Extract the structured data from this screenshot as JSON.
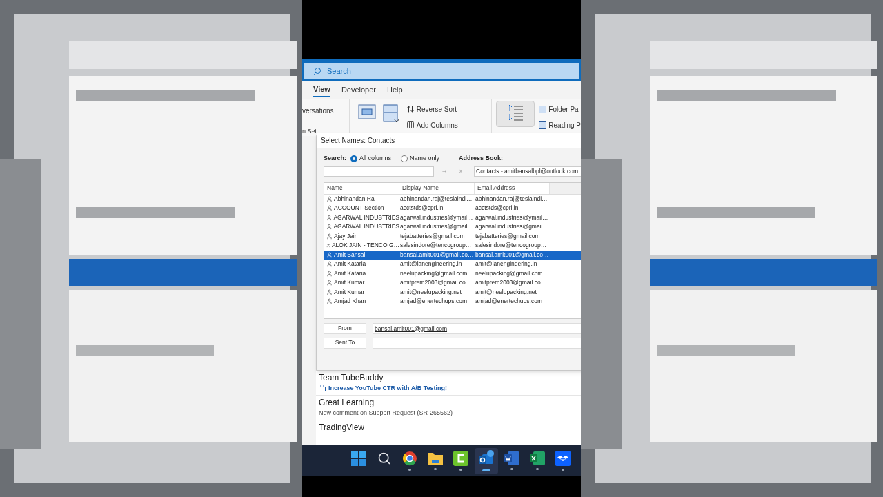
{
  "search": {
    "placeholder": "Search"
  },
  "ribbon_tabs": [
    {
      "label": "View",
      "selected": true
    },
    {
      "label": "Developer",
      "selected": false
    },
    {
      "label": "Help",
      "selected": false
    }
  ],
  "ribbon": {
    "left_labels": [
      "versations",
      "n Set"
    ],
    "commands": [
      "Reverse Sort",
      "Add Columns"
    ],
    "pane_commands": [
      "Folder Pa",
      "Reading P"
    ]
  },
  "dialog": {
    "title": "Select Names: Contacts",
    "search_label": "Search:",
    "search_options": [
      {
        "label": "All columns",
        "selected": true
      },
      {
        "label": "Name only",
        "selected": false
      }
    ],
    "arrow": "→",
    "clear": "×",
    "address_book_label": "Address Book:",
    "address_book": "Contacts - amitbansalbpl@outlook.com",
    "columns": [
      "Name",
      "Display Name",
      "Email Address"
    ],
    "rows": [
      {
        "name": "Abhinandan Raj",
        "display": "abhinandan.raj@teslaindi…",
        "email": "abhinandan.raj@teslaindi…",
        "selected": false
      },
      {
        "name": "ACCOUNT Section",
        "display": "acctstds@cpri.in",
        "email": "acctstds@cpri.in",
        "selected": false
      },
      {
        "name": "AGARWAL INDUSTRIES",
        "display": "agarwal.industries@ymail…",
        "email": "agarwal.industries@ymail…",
        "selected": false
      },
      {
        "name": "AGARWAL INDUSTRIES",
        "display": "agarwal.industries@gmail…",
        "email": "agarwal.industries@gmail…",
        "selected": false
      },
      {
        "name": "Ajay Jain",
        "display": "tejabatteries@gmail.com",
        "email": "tejabatteries@gmail.com",
        "selected": false
      },
      {
        "name": "ALOK JAIN - TENCO G…",
        "display": "salesindore@tencogroup…",
        "email": "salesindore@tencogroup…",
        "selected": false
      },
      {
        "name": "Amit Bansal",
        "display": "bansal.amit001@gmail.co…",
        "email": "bansal.amit001@gmail.co…",
        "selected": true
      },
      {
        "name": "Amit Kataria",
        "display": "amit@lanengineering.in",
        "email": "amit@lanengineering.in",
        "selected": false
      },
      {
        "name": "Amit Kataria",
        "display": "neelupacking@gmail.com",
        "email": "neelupacking@gmail.com",
        "selected": false
      },
      {
        "name": "Amit Kumar",
        "display": "amitprem2003@gmail.co…",
        "email": "amitprem2003@gmail.co…",
        "selected": false
      },
      {
        "name": "Amit Kumar",
        "display": "amit@neelupacking.net",
        "email": "amit@neelupacking.net",
        "selected": false
      },
      {
        "name": "Amjad Khan",
        "display": "amjad@enertechups.com",
        "email": "amjad@enertechups.com",
        "selected": false
      }
    ],
    "from_label": "From",
    "from_value": "bansal.amit001@gmail.com",
    "sent_to_label": "Sent To"
  },
  "messages": [
    {
      "sender": "Team TubeBuddy",
      "subject": "Increase YouTube CTR with A/B Testing!",
      "kind": "promo"
    },
    {
      "sender": "Great Learning",
      "subject": "New comment on Support Request (SR-265562)",
      "kind": "plain"
    },
    {
      "sender": "TradingView"
    }
  ],
  "taskbar": [
    {
      "kind": "start",
      "selected": false
    },
    {
      "kind": "search",
      "selected": false
    },
    {
      "kind": "chrome",
      "selected": false
    },
    {
      "kind": "folder",
      "selected": false
    },
    {
      "kind": "camtasia",
      "selected": false
    },
    {
      "kind": "outlook",
      "selected": true
    },
    {
      "kind": "word",
      "selected": false
    },
    {
      "kind": "excel",
      "selected": false
    },
    {
      "kind": "dropbox",
      "selected": false
    }
  ]
}
